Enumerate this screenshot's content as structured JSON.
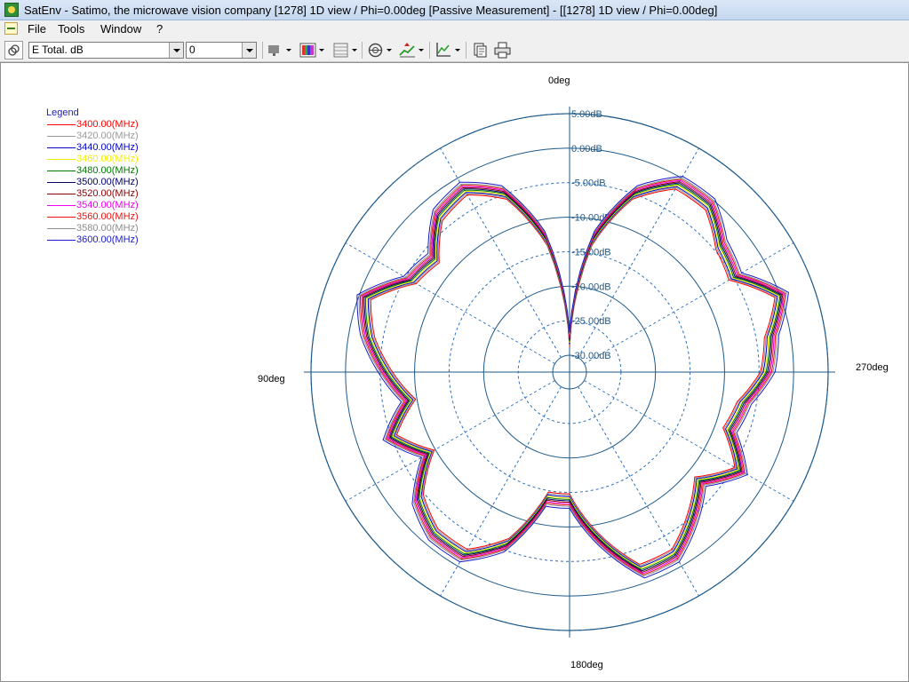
{
  "window": {
    "title": "SatEnv - Satimo, the microwave vision company [1278] 1D view / Phi=0.00deg [Passive Measurement] - [[1278] 1D view / Phi=0.00deg]"
  },
  "menu": {
    "items": [
      {
        "name": "menu-file",
        "label": "File"
      },
      {
        "name": "menu-tools",
        "label": "Tools"
      },
      {
        "name": "menu-window",
        "label": "Window"
      },
      {
        "name": "menu-help",
        "label": "?"
      }
    ]
  },
  "toolbar": {
    "quantity_select": "E Total. dB",
    "value_select": "0",
    "icons": [
      "link-icon",
      "view-3d-icon",
      "color-scale-icon",
      "grid-icon",
      "polar-icon",
      "peak-icon",
      "axis-icon",
      "copy-icon",
      "print-icon"
    ]
  },
  "chart_data": {
    "type": "polar",
    "angle_labels": [
      "0deg",
      "90deg",
      "180deg",
      "270deg"
    ],
    "radial_tick_labels": [
      "5.00dB",
      "0.00dB",
      "-5.00dB",
      "-10.00dB",
      "-15.00dB",
      "-20.00dB",
      "-25.00dB",
      "-30.00dB"
    ],
    "r_range_db": [
      -30,
      5
    ],
    "angle_zero": "top",
    "angle_direction": "counterclockwise",
    "grid": true,
    "legend_placement": "top-left",
    "legend_title": "Legend",
    "colors": {
      "grid_solid": "#1e5a8a",
      "grid_dashed": "#2c6fbd"
    },
    "series": [
      {
        "name": "3400.00(MHz)",
        "color": "#ff0000"
      },
      {
        "name": "3420.00(MHz)",
        "color": "#9a9a9a"
      },
      {
        "name": "3440.00(MHz)",
        "color": "#0000cc"
      },
      {
        "name": "3460.00(MHz)",
        "color": "#f5f000"
      },
      {
        "name": "3480.00(MHz)",
        "color": "#007700"
      },
      {
        "name": "3500.00(MHz)",
        "color": "#000066"
      },
      {
        "name": "3520.00(MHz)",
        "color": "#8b0000"
      },
      {
        "name": "3540.00(MHz)",
        "color": "#ee00ee"
      },
      {
        "name": "3560.00(MHz)",
        "color": "#ee1111"
      },
      {
        "name": "3580.00(MHz)",
        "color": "#8c8c8c"
      },
      {
        "name": "3600.00(MHz)",
        "color": "#1a1acc"
      }
    ],
    "pattern_base": {
      "angles_deg": [
        0,
        10,
        20,
        30,
        40,
        50,
        60,
        70,
        80,
        90,
        100,
        110,
        120,
        130,
        140,
        150,
        160,
        170,
        180,
        190,
        200,
        210,
        220,
        230,
        240,
        250,
        260,
        270,
        280,
        290,
        300,
        310,
        320,
        330,
        340,
        350
      ],
      "gain_db": [
        -28,
        -13,
        -5,
        -2,
        -3,
        -7,
        -6,
        -1,
        -3,
        -6,
        -9,
        -5,
        -9,
        -4,
        -2,
        -2,
        -6,
        -14,
        -14,
        -8,
        -2,
        -2,
        -5,
        -8,
        -4,
        -8,
        -7,
        -4,
        -3,
        0,
        -5,
        -4,
        -1,
        -1,
        -5,
        -13
      ]
    },
    "series_offsets_db": [
      -0.8,
      -0.6,
      -0.4,
      -0.2,
      0,
      0.2,
      0.4,
      0.6,
      0.8,
      1.0,
      1.3
    ]
  }
}
